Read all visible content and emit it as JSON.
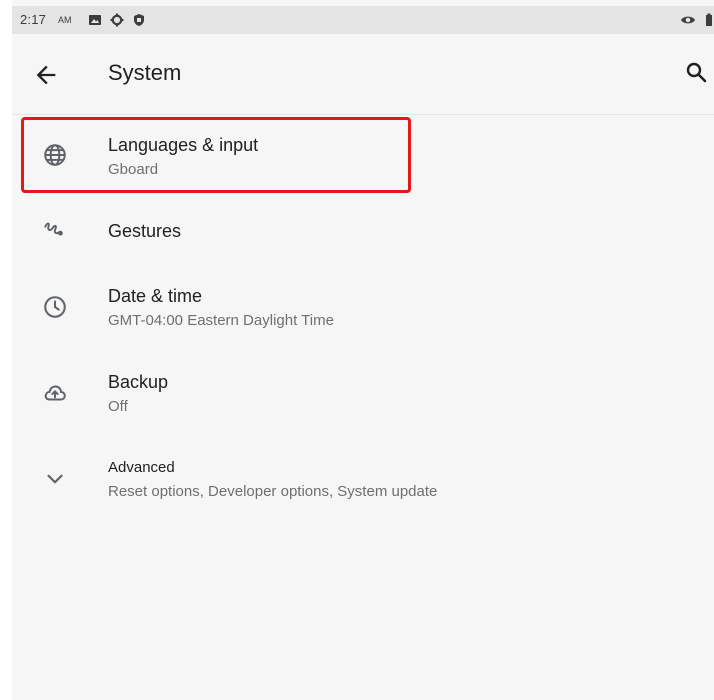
{
  "status_bar": {
    "time": "2:17",
    "ampm": "AM",
    "icons": [
      "image-icon",
      "gear-icon",
      "shield-icon",
      "visibility-icon",
      "battery-icon"
    ]
  },
  "app_bar": {
    "title": "System",
    "back_icon": "arrow-back-icon",
    "search_icon": "search-icon"
  },
  "items": [
    {
      "id": "languages",
      "icon": "globe-icon",
      "title": "Languages & input",
      "subtitle": "Gboard"
    },
    {
      "id": "gestures",
      "icon": "gesture-icon",
      "title": "Gestures",
      "subtitle": ""
    },
    {
      "id": "date-time",
      "icon": "clock-icon",
      "title": "Date & time",
      "subtitle": "GMT-04:00 Eastern Daylight Time"
    },
    {
      "id": "backup",
      "icon": "cloud-upload-icon",
      "title": "Backup",
      "subtitle": "Off"
    },
    {
      "id": "advanced",
      "icon": "chevron-down-icon",
      "title": "Advanced",
      "subtitle": "Reset options, Developer options, System update"
    }
  ],
  "colors": {
    "highlight": "#e8151b",
    "background": "#f6f6f6",
    "status_bar": "#e4e4e4",
    "text_primary": "#202124",
    "text_secondary": "#6f6f6f"
  }
}
